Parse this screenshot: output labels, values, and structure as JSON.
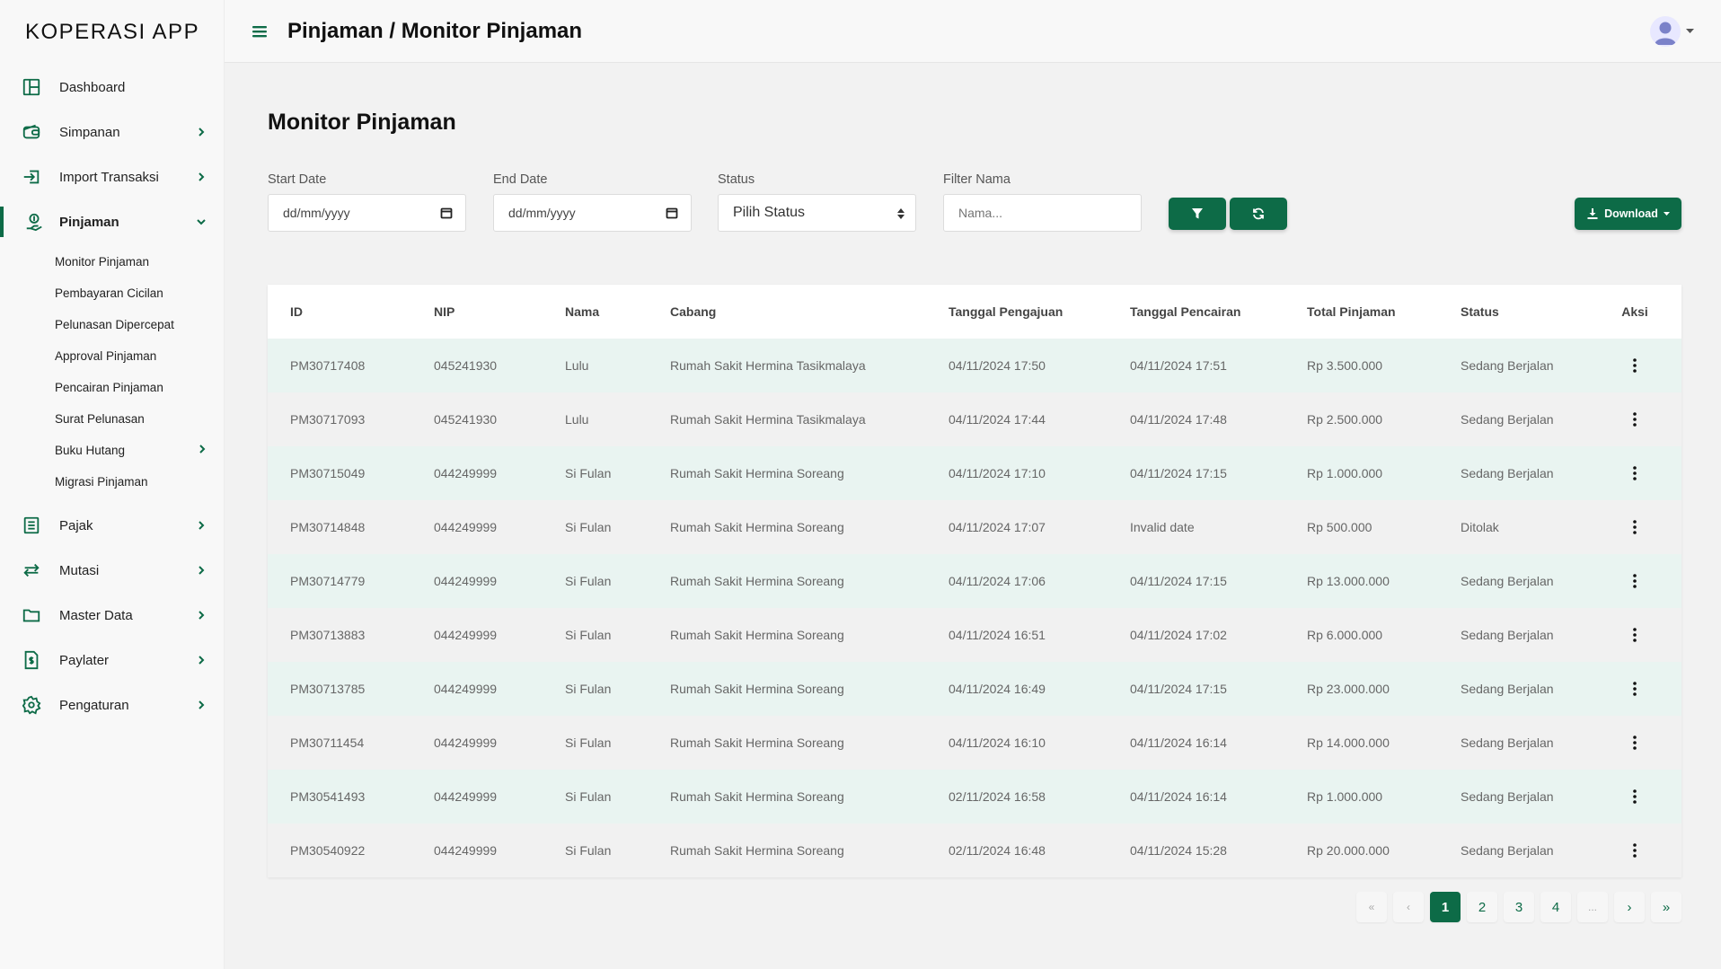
{
  "app": {
    "brand": "KOPERASI APP"
  },
  "header": {
    "breadcrumb": "Pinjaman / Monitor Pinjaman"
  },
  "colors": {
    "primary": "#0d6b47",
    "row_alt": "#e9f4f1"
  },
  "sidebar": {
    "items": [
      {
        "label": "Dashboard",
        "icon": "dashboard-icon"
      },
      {
        "label": "Simpanan",
        "icon": "wallet-icon"
      },
      {
        "label": "Import Transaksi",
        "icon": "import-icon"
      },
      {
        "label": "Pinjaman",
        "icon": "hand-coin-icon"
      },
      {
        "label": "Pajak",
        "icon": "list-icon"
      },
      {
        "label": "Mutasi",
        "icon": "arrows-icon"
      },
      {
        "label": "Master Data",
        "icon": "folder-icon"
      },
      {
        "label": "Paylater",
        "icon": "invoice-icon"
      },
      {
        "label": "Pengaturan",
        "icon": "gear-icon"
      }
    ],
    "sub_items": [
      "Monitor Pinjaman",
      "Pembayaran Cicilan",
      "Pelunasan Dipercepat",
      "Approval Pinjaman",
      "Pencairan Pinjaman",
      "Surat Pelunasan",
      "Buku Hutang",
      "Migrasi Pinjaman"
    ]
  },
  "main": {
    "title": "Monitor Pinjaman",
    "filters": {
      "start_label": "Start Date",
      "start_value": "dd/mm/yyyy",
      "end_label": "End Date",
      "end_value": "dd/mm/yyyy",
      "status_label": "Status",
      "status_value": "Pilih Status",
      "nama_label": "Filter Nama",
      "nama_placeholder": "Nama..."
    },
    "download_label": "Download",
    "table": {
      "headers": [
        "ID",
        "NIP",
        "Nama",
        "Cabang",
        "Tanggal Pengajuan",
        "Tanggal Pencairan",
        "Total Pinjaman",
        "Status",
        "Aksi"
      ],
      "rows": [
        [
          "PM30717408",
          "045241930",
          "Lulu",
          "Rumah Sakit Hermina Tasikmalaya",
          "04/11/2024 17:50",
          "04/11/2024 17:51",
          "Rp 3.500.000",
          "Sedang Berjalan"
        ],
        [
          "PM30717093",
          "045241930",
          "Lulu",
          "Rumah Sakit Hermina Tasikmalaya",
          "04/11/2024 17:44",
          "04/11/2024 17:48",
          "Rp 2.500.000",
          "Sedang Berjalan"
        ],
        [
          "PM30715049",
          "044249999",
          "Si Fulan",
          "Rumah Sakit Hermina Soreang",
          "04/11/2024 17:10",
          "04/11/2024 17:15",
          "Rp 1.000.000",
          "Sedang Berjalan"
        ],
        [
          "PM30714848",
          "044249999",
          "Si Fulan",
          "Rumah Sakit Hermina Soreang",
          "04/11/2024 17:07",
          "Invalid date",
          "Rp 500.000",
          "Ditolak"
        ],
        [
          "PM30714779",
          "044249999",
          "Si Fulan",
          "Rumah Sakit Hermina Soreang",
          "04/11/2024 17:06",
          "04/11/2024 17:15",
          "Rp 13.000.000",
          "Sedang Berjalan"
        ],
        [
          "PM30713883",
          "044249999",
          "Si Fulan",
          "Rumah Sakit Hermina Soreang",
          "04/11/2024 16:51",
          "04/11/2024 17:02",
          "Rp 6.000.000",
          "Sedang Berjalan"
        ],
        [
          "PM30713785",
          "044249999",
          "Si Fulan",
          "Rumah Sakit Hermina Soreang",
          "04/11/2024 16:49",
          "04/11/2024 17:15",
          "Rp 23.000.000",
          "Sedang Berjalan"
        ],
        [
          "PM30711454",
          "044249999",
          "Si Fulan",
          "Rumah Sakit Hermina Soreang",
          "04/11/2024 16:10",
          "04/11/2024 16:14",
          "Rp 14.000.000",
          "Sedang Berjalan"
        ],
        [
          "PM30541493",
          "044249999",
          "Si Fulan",
          "Rumah Sakit Hermina Soreang",
          "02/11/2024 16:58",
          "04/11/2024 16:14",
          "Rp 1.000.000",
          "Sedang Berjalan"
        ],
        [
          "PM30540922",
          "044249999",
          "Si Fulan",
          "Rumah Sakit Hermina Soreang",
          "02/11/2024 16:48",
          "04/11/2024 15:28",
          "Rp 20.000.000",
          "Sedang Berjalan"
        ]
      ]
    },
    "pagination": {
      "first": "«",
      "prev": "‹",
      "pages": [
        "1",
        "2",
        "3",
        "4"
      ],
      "ellipsis": "...",
      "next": "›",
      "last": "»",
      "current": "1"
    }
  }
}
